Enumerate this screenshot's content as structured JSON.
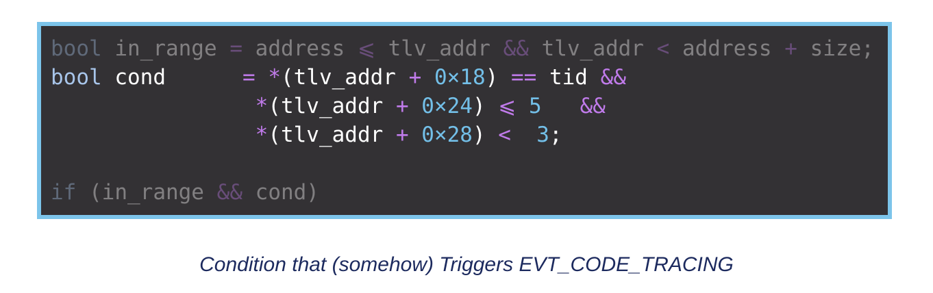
{
  "code": {
    "lines": [
      {
        "dim": true,
        "tokens": [
          {
            "t": "bool",
            "c": "kw"
          },
          {
            "t": " ",
            "c": "pun"
          },
          {
            "t": "in_range",
            "c": "id"
          },
          {
            "t": " ",
            "c": "pun"
          },
          {
            "t": "=",
            "c": "op"
          },
          {
            "t": " ",
            "c": "pun"
          },
          {
            "t": "address",
            "c": "id"
          },
          {
            "t": " ",
            "c": "pun"
          },
          {
            "t": "⩽",
            "c": "op"
          },
          {
            "t": " ",
            "c": "pun"
          },
          {
            "t": "tlv_addr",
            "c": "id"
          },
          {
            "t": " ",
            "c": "pun"
          },
          {
            "t": "&&",
            "c": "op"
          },
          {
            "t": " ",
            "c": "pun"
          },
          {
            "t": "tlv_addr",
            "c": "id"
          },
          {
            "t": " ",
            "c": "pun"
          },
          {
            "t": "<",
            "c": "op"
          },
          {
            "t": " ",
            "c": "pun"
          },
          {
            "t": "address",
            "c": "id"
          },
          {
            "t": " ",
            "c": "pun"
          },
          {
            "t": "+",
            "c": "op"
          },
          {
            "t": " ",
            "c": "pun"
          },
          {
            "t": "size",
            "c": "id"
          },
          {
            "t": ";",
            "c": "pun"
          }
        ]
      },
      {
        "dim": false,
        "tokens": [
          {
            "t": "bool",
            "c": "kw"
          },
          {
            "t": " ",
            "c": "pun"
          },
          {
            "t": "cond",
            "c": "id"
          },
          {
            "t": "      ",
            "c": "pun"
          },
          {
            "t": "=",
            "c": "op"
          },
          {
            "t": " ",
            "c": "pun"
          },
          {
            "t": "*",
            "c": "op"
          },
          {
            "t": "(tlv_addr",
            "c": "id"
          },
          {
            "t": " ",
            "c": "pun"
          },
          {
            "t": "+",
            "c": "op"
          },
          {
            "t": " ",
            "c": "pun"
          },
          {
            "t": "0×18",
            "c": "num"
          },
          {
            "t": ")",
            "c": "pun"
          },
          {
            "t": " ",
            "c": "pun"
          },
          {
            "t": "==",
            "c": "op"
          },
          {
            "t": " ",
            "c": "pun"
          },
          {
            "t": "tid",
            "c": "id"
          },
          {
            "t": " ",
            "c": "pun"
          },
          {
            "t": "&&",
            "c": "op"
          }
        ]
      },
      {
        "dim": false,
        "tokens": [
          {
            "t": "                ",
            "c": "pun"
          },
          {
            "t": "*",
            "c": "op"
          },
          {
            "t": "(tlv_addr",
            "c": "id"
          },
          {
            "t": " ",
            "c": "pun"
          },
          {
            "t": "+",
            "c": "op"
          },
          {
            "t": " ",
            "c": "pun"
          },
          {
            "t": "0×24",
            "c": "num"
          },
          {
            "t": ")",
            "c": "pun"
          },
          {
            "t": " ",
            "c": "pun"
          },
          {
            "t": "⩽",
            "c": "op"
          },
          {
            "t": " ",
            "c": "pun"
          },
          {
            "t": "5",
            "c": "num"
          },
          {
            "t": "   ",
            "c": "pun"
          },
          {
            "t": "&&",
            "c": "op"
          }
        ]
      },
      {
        "dim": false,
        "tokens": [
          {
            "t": "                ",
            "c": "pun"
          },
          {
            "t": "*",
            "c": "op"
          },
          {
            "t": "(tlv_addr",
            "c": "id"
          },
          {
            "t": " ",
            "c": "pun"
          },
          {
            "t": "+",
            "c": "op"
          },
          {
            "t": " ",
            "c": "pun"
          },
          {
            "t": "0×28",
            "c": "num"
          },
          {
            "t": ")",
            "c": "pun"
          },
          {
            "t": " ",
            "c": "pun"
          },
          {
            "t": "<",
            "c": "op"
          },
          {
            "t": "  ",
            "c": "pun"
          },
          {
            "t": "3",
            "c": "num"
          },
          {
            "t": ";",
            "c": "pun"
          }
        ]
      },
      {
        "dim": false,
        "tokens": []
      },
      {
        "dim": true,
        "tokens": [
          {
            "t": "if",
            "c": "kw"
          },
          {
            "t": " ",
            "c": "pun"
          },
          {
            "t": "(in_range",
            "c": "id"
          },
          {
            "t": " ",
            "c": "pun"
          },
          {
            "t": "&&",
            "c": "op"
          },
          {
            "t": " ",
            "c": "pun"
          },
          {
            "t": "cond)",
            "c": "id"
          }
        ]
      }
    ]
  },
  "caption": "Condition that (somehow) Triggers EVT_CODE_TRACING",
  "colors": {
    "frame_border": "#7cc4ea",
    "code_background": "#333134",
    "keyword": "#a8c5ea",
    "operator": "#c07bea",
    "number": "#73bfe8",
    "caption": "#1c2a5e"
  }
}
